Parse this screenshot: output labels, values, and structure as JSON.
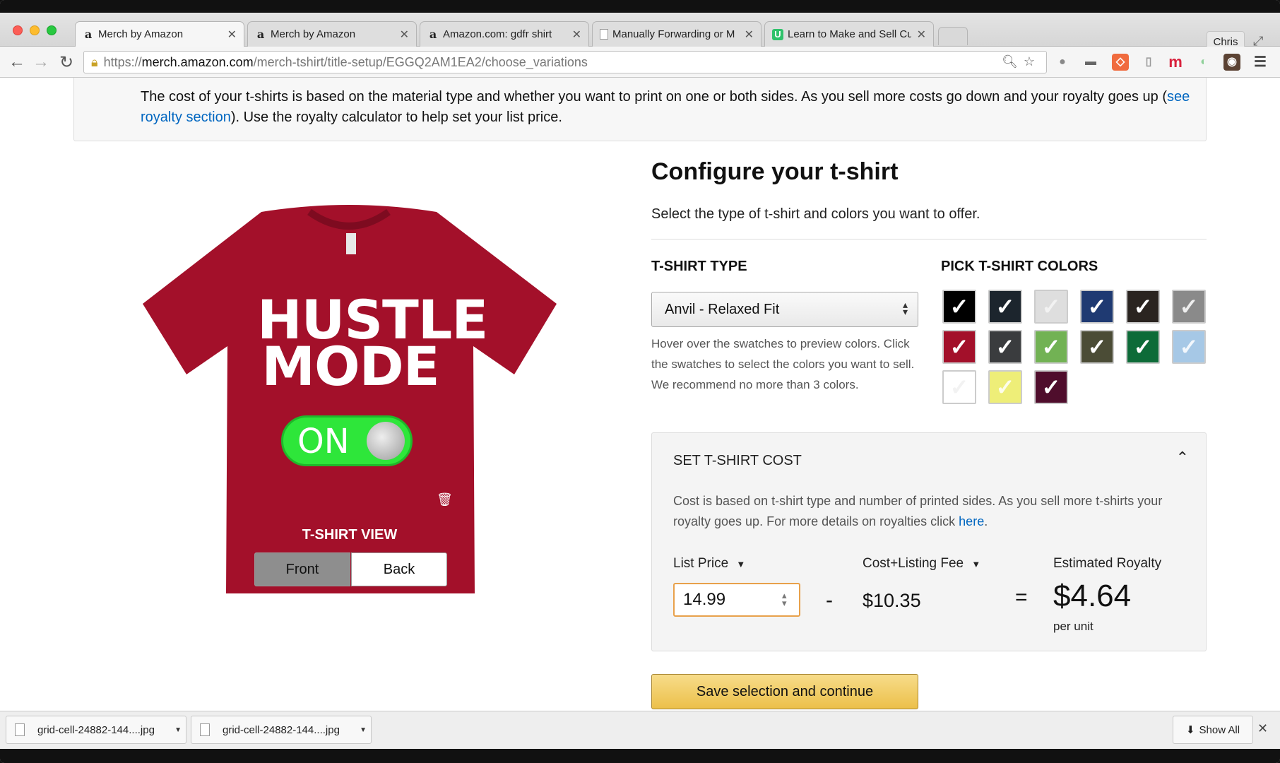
{
  "browser": {
    "tabs": [
      {
        "label": "Merch by Amazon",
        "favicon": "a"
      },
      {
        "label": "Merch by Amazon",
        "favicon": "a"
      },
      {
        "label": "Amazon.com: gdfr shirt",
        "favicon": "a"
      },
      {
        "label": "Manually Forwarding or M",
        "favicon": "doc"
      },
      {
        "label": "Learn to Make and Sell Cu",
        "favicon": "U"
      }
    ],
    "user": "Chris",
    "url_scheme": "https://",
    "url_host": "merch.amazon.com",
    "url_path": "/merch-tshirt/title-setup/EGGQ2AM1EA2/choose_variations",
    "extension_m": "m"
  },
  "notice": {
    "text_before": "The cost of your t-shirts is based on the material type and whether you want to print on one or both sides. As you sell more costs go down and your royalty goes up (",
    "link": "see royalty section",
    "text_after": "). Use the royalty calculator to help set your list price."
  },
  "preview": {
    "design_line1": "HUSTLE",
    "design_line2": "MODE",
    "toggle_text": "ON",
    "shirt_color": "#a3102a",
    "view_label": "T-SHIRT VIEW",
    "front": "Front",
    "back": "Back"
  },
  "config": {
    "title": "Configure your t-shirt",
    "subtitle": "Select the type of t-shirt and colors you want to offer.",
    "type_header": "T-SHIRT TYPE",
    "type_value": "Anvil - Relaxed Fit",
    "type_help": "Hover over the swatches to preview colors. Click the swatches to select the colors you want to sell. We recommend no more than 3 colors.",
    "colors_header": "PICK T-SHIRT COLORS",
    "swatches": [
      {
        "color": "#000000",
        "checked": true
      },
      {
        "color": "#1c252d",
        "checked": true
      },
      {
        "color": "#dedede",
        "checked": false
      },
      {
        "color": "#1f3a72",
        "checked": true
      },
      {
        "color": "#2a2420",
        "checked": true
      },
      {
        "color": "#8a8a8a",
        "checked": false
      },
      {
        "color": "#a3102a",
        "checked": true
      },
      {
        "color": "#3a3c3e",
        "checked": true
      },
      {
        "color": "#72b254",
        "checked": true
      },
      {
        "color": "#4b4c36",
        "checked": true
      },
      {
        "color": "#0d6b38",
        "checked": true
      },
      {
        "color": "#a6c8e6",
        "checked": false
      },
      {
        "color": "#ffffff",
        "checked": false
      },
      {
        "color": "#eeee78",
        "checked": false
      },
      {
        "color": "#4f0d2c",
        "checked": true
      }
    ]
  },
  "cost": {
    "header": "SET T-SHIRT COST",
    "help_before": "Cost is based on t-shirt type and number of printed sides. As you sell more t-shirts your royalty goes up. For more details on royalties click ",
    "help_link": "here",
    "help_after": ".",
    "list_price_label": "List Price",
    "fee_label": "Cost+Listing Fee",
    "royalty_label": "Estimated Royalty",
    "list_price": "14.99",
    "minus": "-",
    "fee": "$10.35",
    "equals": "=",
    "royalty": "$4.64",
    "per_unit": "per unit"
  },
  "actions": {
    "save": "Save selection and continue"
  },
  "downloads": {
    "items": [
      "grid-cell-24882-144....jpg",
      "grid-cell-24882-144....jpg"
    ],
    "show_all": "Show All"
  }
}
